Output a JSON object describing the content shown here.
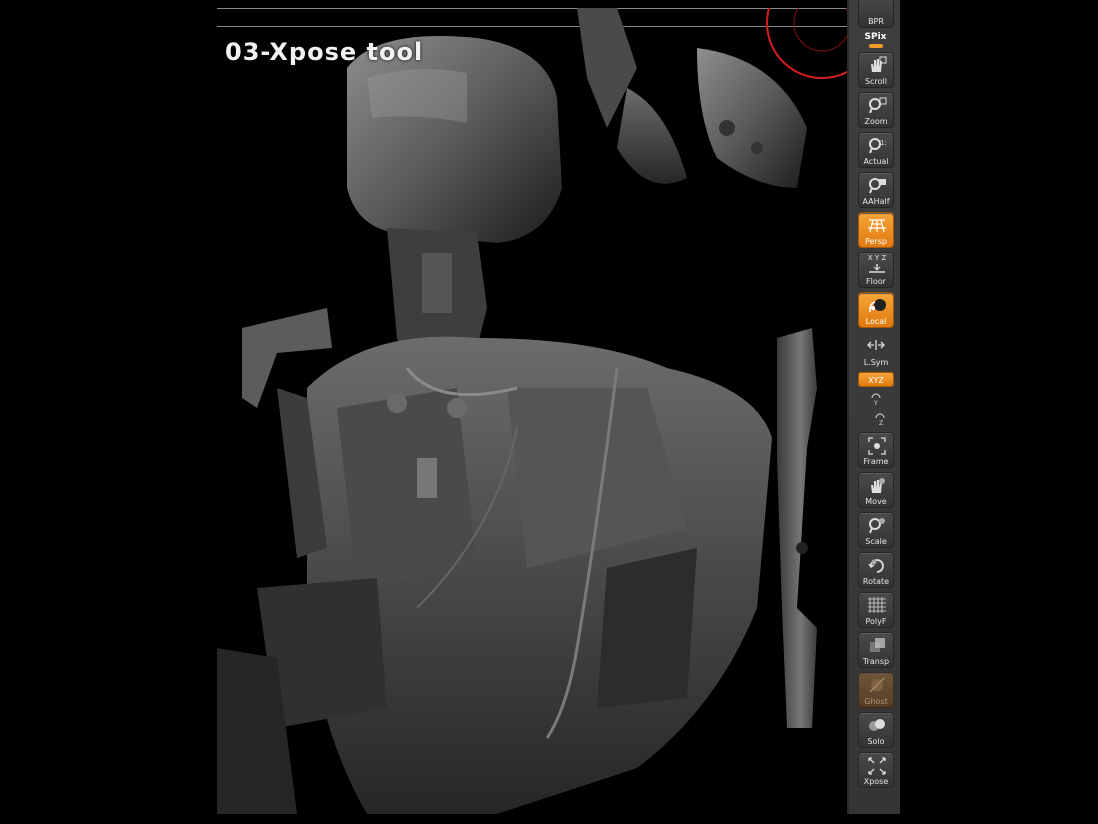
{
  "viewport": {
    "title": "03-Xpose tool"
  },
  "toolbar": {
    "bpr_label": "BPR",
    "spix_label": "SPix",
    "buttons": [
      {
        "label": "Scroll",
        "icon": "hand-scroll-icon",
        "state": "normal"
      },
      {
        "label": "Zoom",
        "icon": "magnifier-zoom-icon",
        "state": "normal"
      },
      {
        "label": "Actual",
        "icon": "magnifier-actual-icon",
        "state": "normal"
      },
      {
        "label": "AAHalf",
        "icon": "magnifier-aahalf-icon",
        "state": "normal"
      },
      {
        "label": "Persp",
        "icon": "perspective-grid-icon",
        "state": "active"
      },
      {
        "label": "Floor",
        "icon": "floor-icon",
        "state": "normal"
      },
      {
        "label": "Local",
        "icon": "local-icon",
        "state": "active"
      },
      {
        "label": "L.Sym",
        "icon": "local-symmetry-icon",
        "state": "normal"
      },
      {
        "label": "Frame",
        "icon": "frame-icon",
        "state": "normal"
      },
      {
        "label": "Move",
        "icon": "move-hand-icon",
        "state": "normal"
      },
      {
        "label": "Scale",
        "icon": "scale-magnifier-icon",
        "state": "normal"
      },
      {
        "label": "Rotate",
        "icon": "rotate-icon",
        "state": "normal"
      },
      {
        "label": "PolyF",
        "icon": "polyframe-grid-icon",
        "state": "normal"
      },
      {
        "label": "Transp",
        "icon": "transparency-icon",
        "state": "normal"
      },
      {
        "label": "Ghost",
        "icon": "ghost-icon",
        "state": "disabled"
      },
      {
        "label": "Solo",
        "icon": "solo-icon",
        "state": "normal"
      },
      {
        "label": "Xpose",
        "icon": "xpose-icon",
        "state": "normal"
      }
    ],
    "xyz_label": "XYZ",
    "floor_axes": "X Y Z",
    "y_label": "Y",
    "z_label": "Z"
  },
  "colors": {
    "accent": "#F29A2E",
    "toolbar_bg": "#3A3A3A",
    "viewport_bg": "#000000",
    "red_circle": "#D21E1E"
  }
}
